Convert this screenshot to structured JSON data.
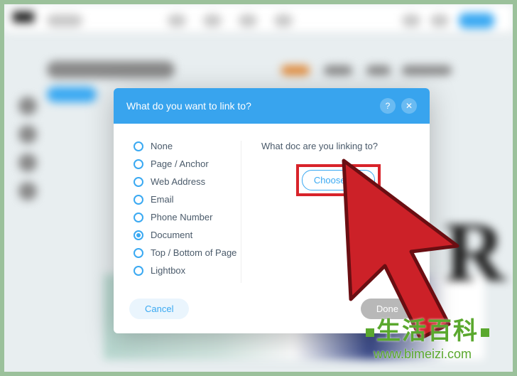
{
  "dialog": {
    "title": "What do you want to link to?",
    "help_label": "?",
    "close_label": "✕",
    "options": [
      {
        "label": "None",
        "selected": false
      },
      {
        "label": "Page / Anchor",
        "selected": false
      },
      {
        "label": "Web Address",
        "selected": false
      },
      {
        "label": "Email",
        "selected": false
      },
      {
        "label": "Phone Number",
        "selected": false
      },
      {
        "label": "Document",
        "selected": true
      },
      {
        "label": "Top / Bottom of Page",
        "selected": false
      },
      {
        "label": "Lightbox",
        "selected": false
      }
    ],
    "right_title": "What doc are you linking to?",
    "choose_file_label": "Choose File",
    "cancel_label": "Cancel",
    "done_label": "Done"
  },
  "watermark": {
    "main": "生活百科",
    "sub": "www.bimeizi.com"
  },
  "background": {
    "big_letter": "R"
  }
}
